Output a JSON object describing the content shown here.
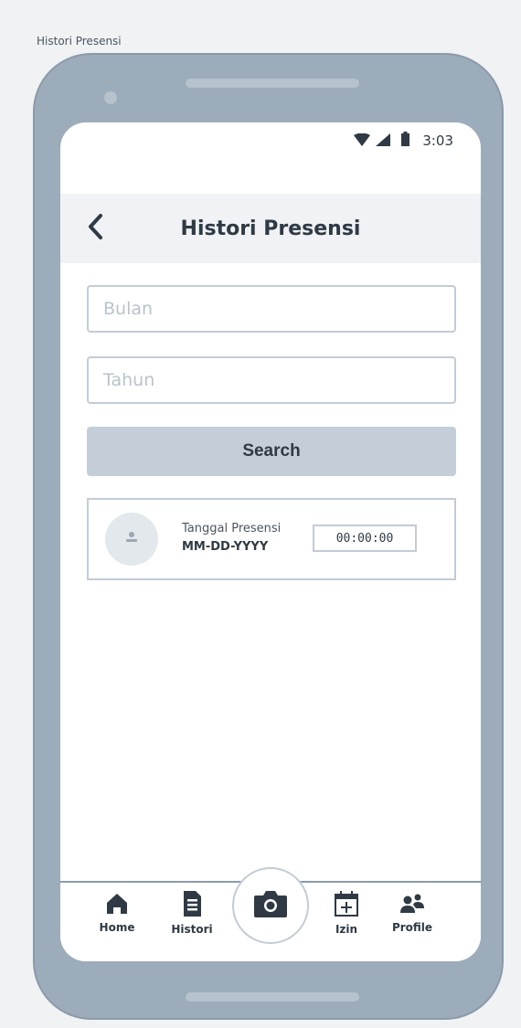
{
  "frame_label": "Histori Presensi",
  "status": {
    "time": "3:03"
  },
  "header": {
    "title": "Histori Presensi"
  },
  "form": {
    "month_placeholder": "Bulan",
    "year_placeholder": "Tahun",
    "search_label": "Search"
  },
  "history": {
    "items": [
      {
        "label": "Tanggal Presensi",
        "date": "MM-DD-YYYY",
        "time": "00:00:00"
      }
    ]
  },
  "nav": {
    "home": "Home",
    "histori": "Histori",
    "izin": "Izin",
    "profile": "Profile"
  },
  "colors": {
    "accent": "#c3ced9",
    "frame": "#9dacba",
    "text": "#2f3a45"
  }
}
